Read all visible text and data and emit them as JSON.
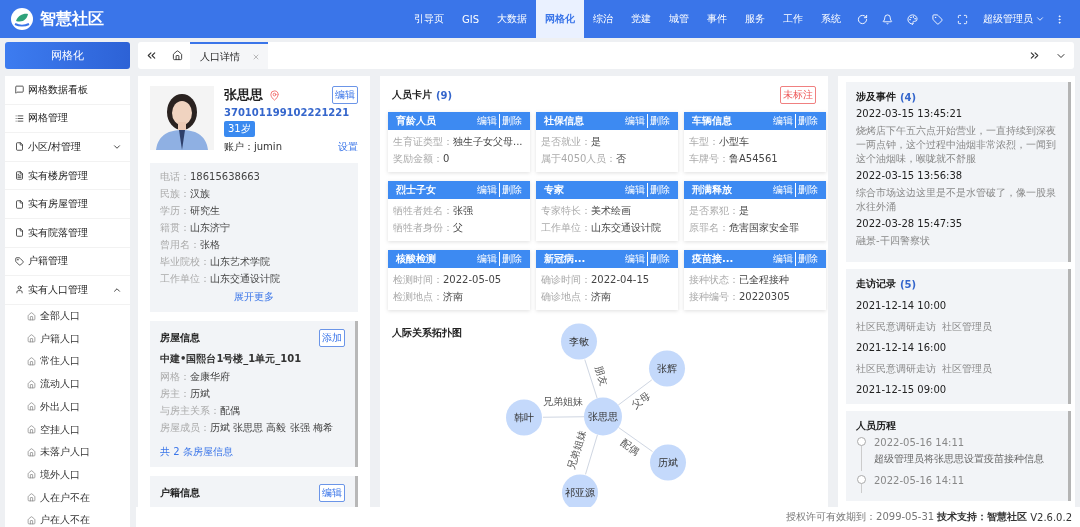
{
  "app": {
    "title": "智慧社区"
  },
  "nav": [
    {
      "label": "引导页",
      "selected": false
    },
    {
      "label": "GIS",
      "selected": false
    },
    {
      "label": "大数据",
      "selected": false
    },
    {
      "label": "网格化",
      "selected": true
    },
    {
      "label": "综治",
      "selected": false
    },
    {
      "label": "党建",
      "selected": false
    },
    {
      "label": "城管",
      "selected": false
    },
    {
      "label": "事件",
      "selected": false
    },
    {
      "label": "服务",
      "selected": false
    },
    {
      "label": "工作",
      "selected": false
    },
    {
      "label": "系统",
      "selected": false
    }
  ],
  "user": "超级管理员",
  "module_button": "网格化",
  "tabs": [
    {
      "label": "人口详情",
      "selected": true
    }
  ],
  "sidebar": {
    "items": [
      {
        "label": "网格数据看板"
      },
      {
        "label": "网格管理"
      },
      {
        "label": "小区/村管理",
        "expanded": false
      },
      {
        "label": "实有楼房管理"
      },
      {
        "label": "实有房屋管理"
      },
      {
        "label": "实有院落管理"
      },
      {
        "label": "户籍管理"
      },
      {
        "label": "实有人口管理",
        "expanded": true,
        "children": [
          {
            "label": "全部人口"
          },
          {
            "label": "户籍人口"
          },
          {
            "label": "常住人口"
          },
          {
            "label": "流动人口"
          },
          {
            "label": "外出人口"
          },
          {
            "label": "空挂人口"
          },
          {
            "label": "未落户人口"
          },
          {
            "label": "境外人口"
          },
          {
            "label": "人在户不在"
          },
          {
            "label": "户在人不在"
          }
        ]
      }
    ]
  },
  "profile": {
    "name": "张思思",
    "edit_button": "编辑",
    "id_number": "370101199102221221",
    "age": "31岁",
    "account": "账户：jumin",
    "settings_link": "设置",
    "details": [
      {
        "label": "电话：",
        "value": "18615638663"
      },
      {
        "label": "民族：",
        "value": "汉族"
      },
      {
        "label": "学历：",
        "value": "研究生"
      },
      {
        "label": "籍贯：",
        "value": "山东济宁"
      },
      {
        "label": "曾用名：",
        "value": "张格"
      },
      {
        "label": "毕业院校：",
        "value": "山东艺术学院"
      },
      {
        "label": "工作单位：",
        "value": "山东交通设计院"
      }
    ],
    "more_link": "展开更多"
  },
  "house": {
    "title": "房屋信息",
    "add_button": "添加",
    "address": "中建•国熙台1号楼_1单元_101",
    "fields": [
      {
        "label": "网格：",
        "value": "金康华府"
      },
      {
        "label": "房主：",
        "value": "历斌"
      },
      {
        "label": "与房主关系：",
        "value": "配偶"
      },
      {
        "label": "房屋成员：",
        "value": "历斌 张思思 高毅 张强 梅希"
      }
    ],
    "count_link": "共 2 条房屋信息"
  },
  "household": {
    "title": "户籍信息",
    "edit_button": "编辑"
  },
  "person_cards": {
    "title": "人员卡片",
    "count": "(9)",
    "tag": "未标注",
    "cards": [
      {
        "title": "育龄人员",
        "edit": "编辑",
        "delete": "删除",
        "fields": [
          {
            "label": "生育证类型：",
            "value": "独生子女父母..."
          },
          {
            "label": "奖励金额：",
            "value": "0"
          }
        ]
      },
      {
        "title": "社保信息",
        "edit": "编辑",
        "delete": "删除",
        "fields": [
          {
            "label": "是否就业：",
            "value": "是"
          },
          {
            "label": "属于4050人员：",
            "value": "否"
          }
        ]
      },
      {
        "title": "车辆信息",
        "edit": "编辑",
        "delete": "删除",
        "fields": [
          {
            "label": "车型：",
            "value": "小型车"
          },
          {
            "label": "车牌号：",
            "value": "鲁A54561"
          }
        ]
      },
      {
        "title": "烈士子女",
        "edit": "编辑",
        "delete": "删除",
        "fields": [
          {
            "label": "牺牲者姓名：",
            "value": "张强"
          },
          {
            "label": "牺牲者身份：",
            "value": "父"
          }
        ]
      },
      {
        "title": "专家",
        "edit": "编辑",
        "delete": "删除",
        "fields": [
          {
            "label": "专家特长：",
            "value": "美术绘画"
          },
          {
            "label": "工作单位：",
            "value": "山东交通设计院"
          }
        ]
      },
      {
        "title": "刑满释放",
        "edit": "编辑",
        "delete": "删除",
        "fields": [
          {
            "label": "是否累犯：",
            "value": "是"
          },
          {
            "label": "原罪名：",
            "value": "危害国家安全罪"
          }
        ]
      },
      {
        "title": "核酸检测",
        "edit": "编辑",
        "delete": "删除",
        "fields": [
          {
            "label": "检测时间：",
            "value": "2022-05-05"
          },
          {
            "label": "检测地点：",
            "value": "济南"
          }
        ]
      },
      {
        "title": "新冠病...",
        "edit": "编辑",
        "delete": "删除",
        "fields": [
          {
            "label": "确诊时间：",
            "value": "2022-04-15"
          },
          {
            "label": "确诊地点：",
            "value": "济南"
          }
        ]
      },
      {
        "title": "疫苗接...",
        "edit": "编辑",
        "delete": "删除",
        "fields": [
          {
            "label": "接种状态：",
            "value": "已全程接种"
          },
          {
            "label": "接种编号：",
            "value": "20220305"
          }
        ]
      }
    ]
  },
  "graph": {
    "title": "人际关系拓扑图",
    "center": "张思思",
    "nodes": [
      {
        "name": "李敏",
        "relation": "朋友"
      },
      {
        "name": "张辉",
        "relation": "父母"
      },
      {
        "name": "历斌",
        "relation": "配偶"
      },
      {
        "name": "祁亚源",
        "relation": "兄弟姐妹"
      },
      {
        "name": "韩叶",
        "relation": "兄弟姐妹"
      }
    ]
  },
  "events": {
    "title": "涉及事件",
    "count": "(4)",
    "items": [
      {
        "time": "2022-03-15 13:45:21",
        "text": "烧烤店下午五六点开始营业，一直持续到深夜一两点钟，这个过程中油烟非常浓烈，一闻到这个油烟味，喉咙就不舒服"
      },
      {
        "time": "2022-03-15 13:56:38",
        "text": "综合市场这边这里是不是水管破了，像一股泉水往外涌"
      },
      {
        "time": "2022-03-28 15:47:35",
        "text": "融景-干四警察状"
      }
    ]
  },
  "visits": {
    "title": "走访记录",
    "count": "(5)",
    "items": [
      {
        "time": "2021-12-14 10:00",
        "purpose": "社区民意调研走访",
        "person": "社区管理员"
      },
      {
        "time": "2021-12-14 16:00",
        "purpose": "社区民意调研走访",
        "person": "社区管理员"
      },
      {
        "time": "2021-12-15 09:00"
      }
    ]
  },
  "history": {
    "title": "人员历程",
    "items": [
      {
        "time": "2022-05-16 14:11",
        "text": "超级管理员将张思思设置疫苗接种信息"
      },
      {
        "time": "2022-05-16 14:11"
      }
    ]
  },
  "footer": {
    "license": "授权许可有效期到：2099-05-31",
    "support": "技术支持：智慧社区",
    "version": "V2.6.0.2"
  }
}
